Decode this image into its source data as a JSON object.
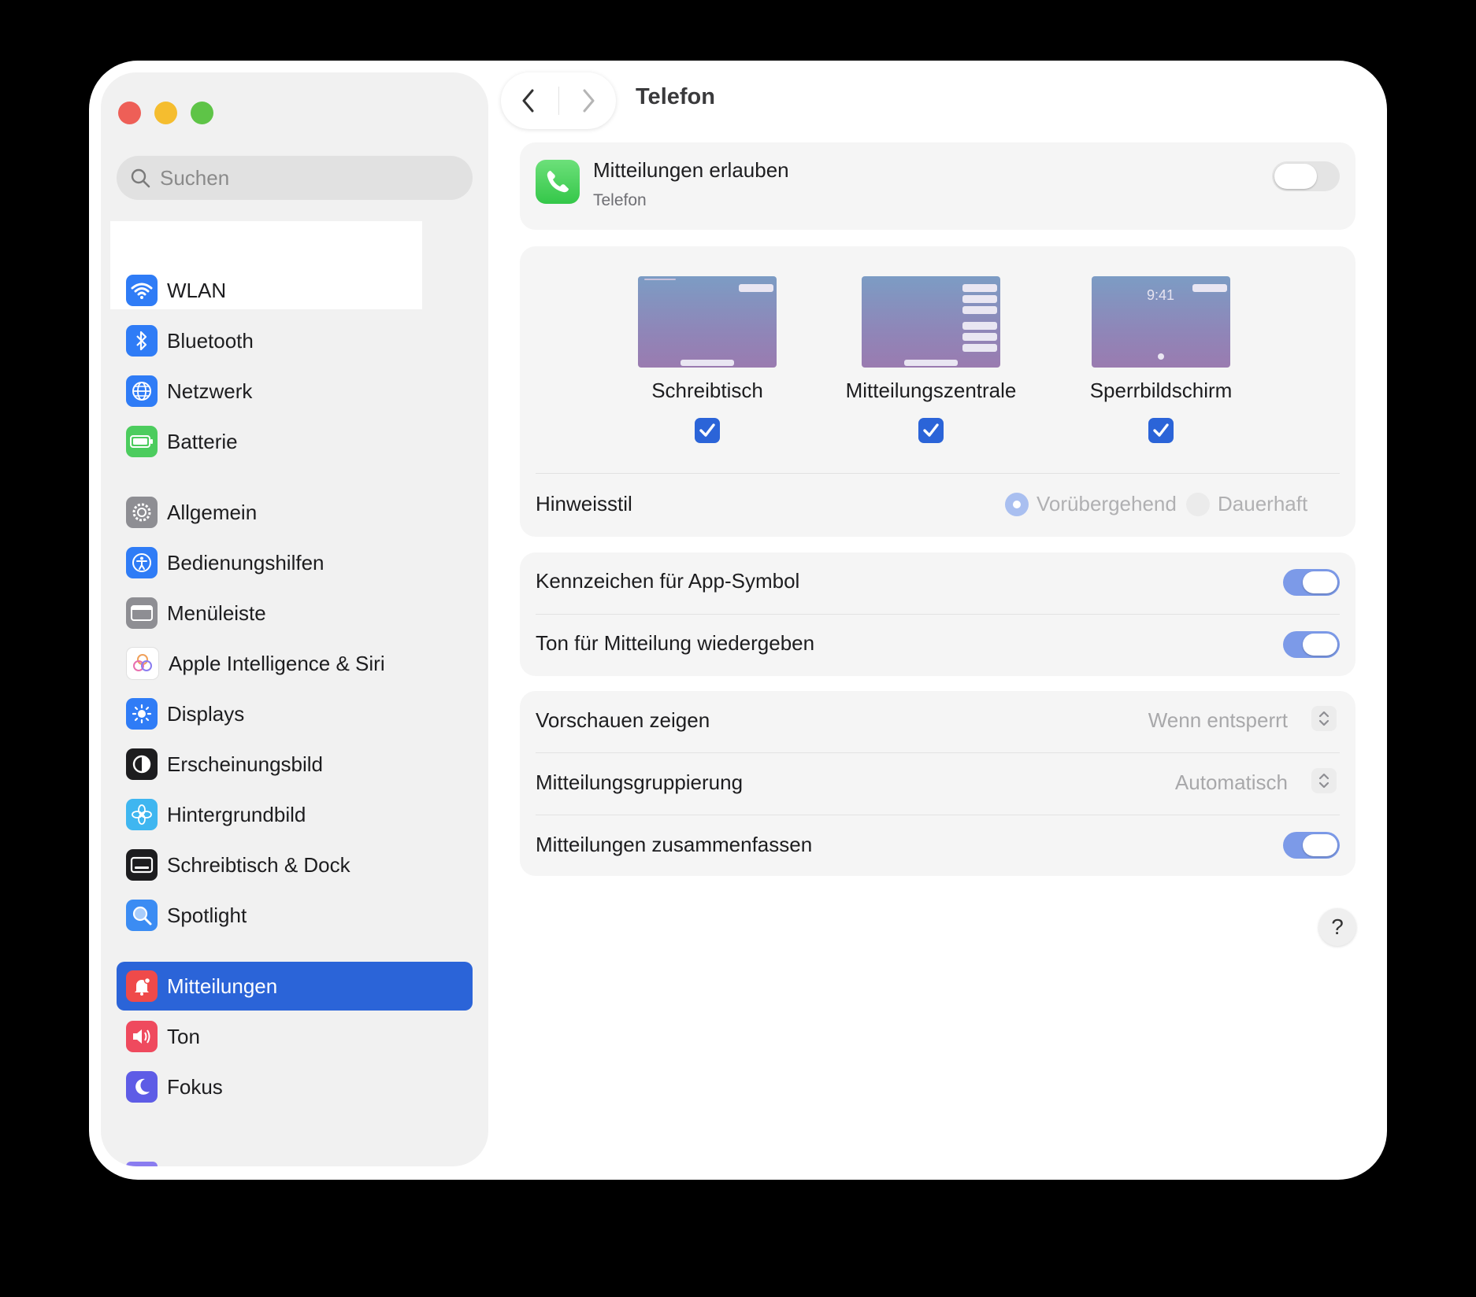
{
  "window": {
    "title": "Telefon"
  },
  "sidebar": {
    "search_placeholder": "Suchen",
    "items": [
      {
        "label": "WLAN",
        "icon": "wifi-icon",
        "color": "#2f7cf6"
      },
      {
        "label": "Bluetooth",
        "icon": "bluetooth-icon",
        "color": "#2f7cf6"
      },
      {
        "label": "Netzwerk",
        "icon": "globe-icon",
        "color": "#2f7cf6"
      },
      {
        "label": "Batterie",
        "icon": "battery-icon",
        "color": "#4ccc5e"
      },
      {
        "label": "Allgemein",
        "icon": "gear-icon",
        "color": "#8e8e93"
      },
      {
        "label": "Bedienungshilfen",
        "icon": "accessibility-icon",
        "color": "#2f7cf6"
      },
      {
        "label": "Menüleiste",
        "icon": "menubar-icon",
        "color": "#8e8e93"
      },
      {
        "label": "Apple Intelligence & Siri",
        "icon": "siri-icon",
        "color": "#e87fb0"
      },
      {
        "label": "Displays",
        "icon": "brightness-icon",
        "color": "#2f7cf6"
      },
      {
        "label": "Erscheinungsbild",
        "icon": "appearance-icon",
        "color": "#1d1d1f"
      },
      {
        "label": "Hintergrundbild",
        "icon": "flower-icon",
        "color": "#3fb6f0"
      },
      {
        "label": "Schreibtisch & Dock",
        "icon": "dock-icon",
        "color": "#1d1d1f"
      },
      {
        "label": "Spotlight",
        "icon": "magnifier-icon",
        "color": "#3b8cf3"
      },
      {
        "label": "Mitteilungen",
        "icon": "bell-icon",
        "color": "#ef4a4a",
        "selected": true
      },
      {
        "label": "Ton",
        "icon": "speaker-icon",
        "color": "#ef4a5e"
      },
      {
        "label": "Fokus",
        "icon": "moon-icon",
        "color": "#5e5ce6"
      }
    ]
  },
  "header": {
    "back_icon": "chevron-left-icon",
    "forward_icon": "chevron-right-icon"
  },
  "allow": {
    "title": "Mitteilungen erlauben",
    "subtitle": "Telefon",
    "enabled": false,
    "icon": "phone-icon"
  },
  "styles": {
    "options": [
      {
        "label": "Schreibtisch",
        "checked": true
      },
      {
        "label": "Mitteilungszentrale",
        "checked": true
      },
      {
        "label": "Sperrbildschirm",
        "checked": true,
        "clock": "9:41"
      }
    ],
    "alert_style_label": "Hinweisstil",
    "alert_options": [
      {
        "label": "Vorübergehend",
        "selected": true
      },
      {
        "label": "Dauerhaft",
        "selected": false
      }
    ]
  },
  "toggles": [
    {
      "label": "Kennzeichen für App-Symbol",
      "on": true
    },
    {
      "label": "Ton für Mitteilung wiedergeben",
      "on": true
    }
  ],
  "options": {
    "previews": {
      "label": "Vorschauen zeigen",
      "value": "Wenn entsperrt"
    },
    "grouping": {
      "label": "Mitteilungsgruppierung",
      "value": "Automatisch"
    },
    "summarize": {
      "label": "Mitteilungen zusammenfassen",
      "on": true
    }
  },
  "help": "?",
  "colors": {
    "accent": "#2b64d8",
    "toggle_on": "#7c9ae8",
    "toggle_off": "#e4e4e4"
  }
}
